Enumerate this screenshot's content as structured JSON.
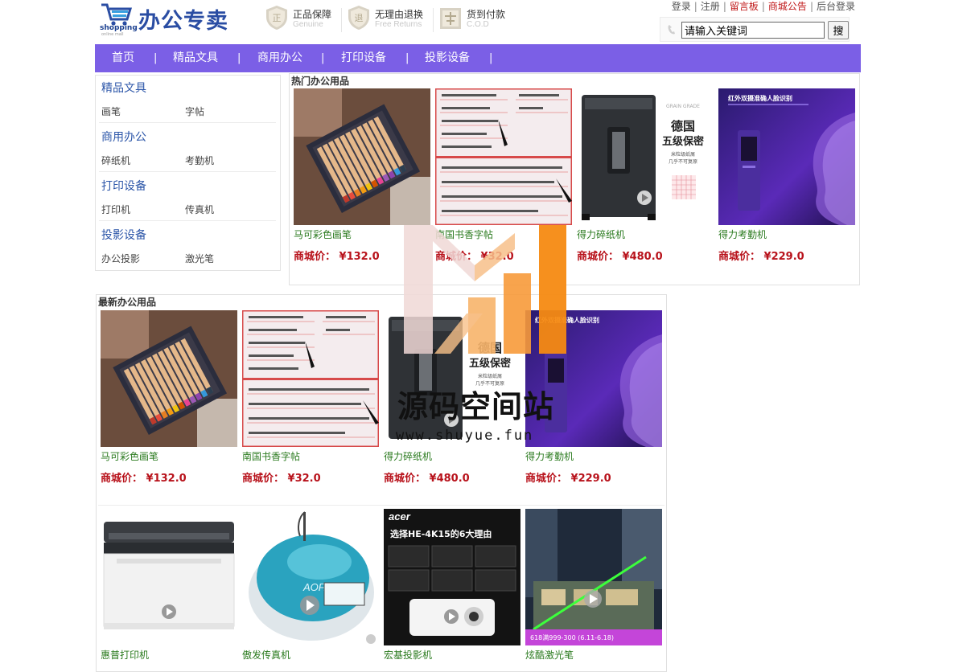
{
  "header": {
    "logo_text": "办公专卖",
    "logo_sub": "shopping",
    "logo_sub2": "online mall",
    "badges": [
      {
        "title": "正品保障",
        "sub": "Genuine",
        "icon": "genuine-shield-icon"
      },
      {
        "title": "无理由退换",
        "sub": "Free Returns",
        "icon": "free-return-shield-icon"
      },
      {
        "title": "货到付款",
        "sub": "C.O.D",
        "icon": "cod-box-icon"
      }
    ],
    "top_links": {
      "login": "登录",
      "register": "注册",
      "guestbook": "留言板",
      "notice": "商城公告",
      "admin": "后台登录"
    },
    "search": {
      "value": "请输入关键词",
      "button": "搜"
    }
  },
  "nav": {
    "items": [
      "首页",
      "精品文具",
      "商用办公",
      "打印设备",
      "投影设备"
    ],
    "sep": "|"
  },
  "sidebar": {
    "categories": [
      {
        "title": "精品文具",
        "links": [
          "画笔",
          "字帖"
        ]
      },
      {
        "title": "商用办公",
        "links": [
          "碎纸机",
          "考勤机"
        ]
      },
      {
        "title": "打印设备",
        "links": [
          "打印机",
          "传真机"
        ]
      },
      {
        "title": "投影设备",
        "links": [
          "办公投影",
          "激光笔"
        ]
      }
    ]
  },
  "hot": {
    "title": "热门办公用品",
    "products": [
      {
        "name": "马可彩色画笔",
        "price": "商城价： ¥132.0"
      },
      {
        "name": "南国书香字帖",
        "price": "商城价： ¥32.0"
      },
      {
        "name": "得力碎纸机",
        "price": "商城价： ¥480.0"
      },
      {
        "name": "得力考勤机",
        "price": "商城价： ¥229.0"
      }
    ]
  },
  "latest": {
    "title": "最新办公用品",
    "products": [
      {
        "name": "马可彩色画笔",
        "price": "商城价： ¥132.0"
      },
      {
        "name": "南国书香字帖",
        "price": "商城价： ¥32.0"
      },
      {
        "name": "得力碎纸机",
        "price": "商城价： ¥480.0"
      },
      {
        "name": "得力考勤机",
        "price": "商城价： ¥229.0"
      },
      {
        "name": "惠普打印机"
      },
      {
        "name": "傲发传真机"
      },
      {
        "name": "宏基投影机"
      },
      {
        "name": "炫酷激光笔"
      }
    ]
  },
  "image_text": {
    "shredder_big": "德国",
    "shredder_big2": "五级保密",
    "shredder_small": "米粒级纸屑",
    "shredder_small2": "几乎不可复原",
    "shredder_brand": "GRAIN GRADE",
    "attendance_banner": "红外双摄准确人脸识别",
    "fax_brand": "AOFAX",
    "projector_brand": "acer",
    "projector_title": "选择HE-4K15的6大理由",
    "laser_caption": "618满999-300 (6.11-6.18)"
  },
  "watermark": {
    "title": "源码空间站",
    "url": "www.shuyue.fun"
  },
  "colors": {
    "nav_bg": "#7b5fe6",
    "link_blue": "#2b55a8",
    "product_name": "#2a7a1e",
    "price_red": "#b8121b",
    "top_link_red": "#c0191a"
  }
}
